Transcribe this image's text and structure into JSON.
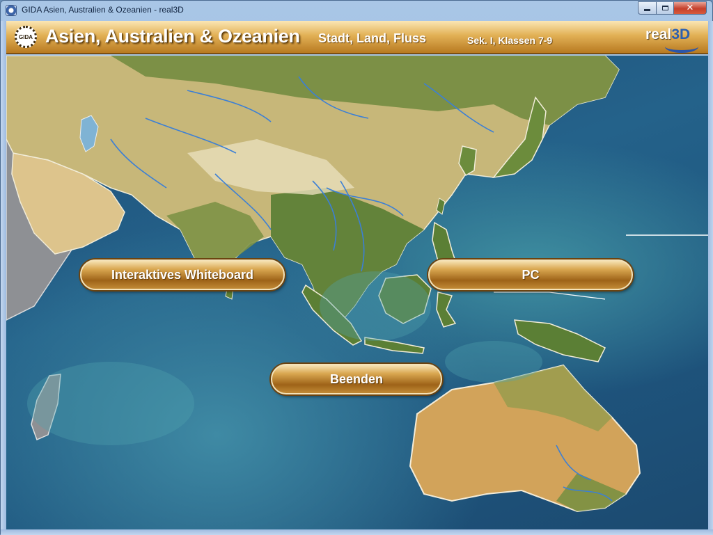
{
  "window": {
    "title": "GIDA Asien, Australien & Ozeanien - real3D",
    "controls": {
      "minimize": "",
      "maximize": "",
      "close": "✕"
    }
  },
  "header": {
    "logo": "GIDA",
    "title": "Asien, Australien & Ozeanien",
    "subtitle": "Stadt, Land, Fluss",
    "grade": "Sek. I, Klassen 7-9",
    "brand_text": "real",
    "brand_3d": "3D"
  },
  "menu": {
    "whiteboard": "Interaktives Whiteboard",
    "pc": "PC",
    "quit": "Beenden"
  },
  "colors": {
    "ocean": "#1f557e",
    "shallow": "#3f8fa0",
    "land_green": "#5d7f3a",
    "land_sand": "#d9c88e",
    "land_desert": "#e6d6a2",
    "river": "#3b7fd6",
    "button_gold": "#b27a28"
  }
}
